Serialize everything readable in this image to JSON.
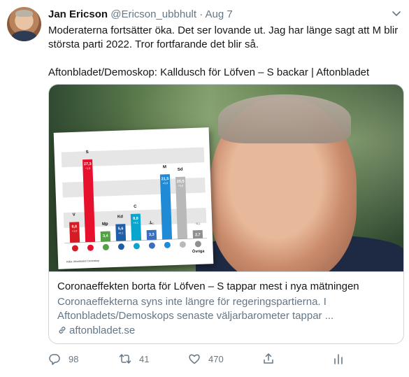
{
  "tweet": {
    "author_name": "Jan Ericson",
    "handle": "@Ericson_ubbhult",
    "separator": "·",
    "date": "Aug 7",
    "text_lines": [
      "Moderaterna fortsätter öka. Det ser lovande ut. Jag har länge sagt att M blir",
      "största parti 2022. Tror fortfarande det blir så."
    ],
    "link_line": "Aftonbladet/Demoskop: Kalldusch för Löfven – S backar | Aftonbladet"
  },
  "card": {
    "title": "Coronaeffekten borta för Löfven – S tappar mest i nya mätningen",
    "desc_lines": [
      "Coronaeffekterna syns inte längre för regeringspartierna. I",
      "Aftonbladets/Demoskops senaste väljarbarometer tappar ..."
    ],
    "domain": "aftonbladet.se"
  },
  "chart_data": {
    "type": "bar",
    "categories": [
      "V",
      "S",
      "Mp",
      "Kd",
      "C",
      "L",
      "M",
      "Sd",
      "Övriga"
    ],
    "values": [
      6.8,
      27.3,
      3.4,
      5.6,
      8.8,
      3.3,
      21.5,
      20.5,
      2.7
    ],
    "value_labels": [
      "6,8",
      "27,3",
      "3,4",
      "5,6",
      "8,8",
      "3,3",
      "21,5",
      "20,5",
      "2,7"
    ],
    "changes": [
      "+1,0",
      "−1,5",
      "−0,7",
      "+0,1",
      "+0,1",
      "+0,1",
      "+0,9",
      "+0,8",
      "−0,1"
    ],
    "colors": [
      "#d61b25",
      "#e8112d",
      "#53a045",
      "#1f5fa8",
      "#0aa5cc",
      "#3a6fbf",
      "#1f8ad6",
      "#b9b9b9",
      "#8f8f8f"
    ],
    "source": "Källa: Aftonbladet/ Demoskop",
    "ylim": [
      0,
      30
    ],
    "grid": true
  },
  "stats": {
    "replies": "98",
    "retweets": "41",
    "likes": "470"
  },
  "icons": {
    "reply": "reply-icon",
    "retweet": "retweet-icon",
    "like": "heart-icon",
    "share": "share-icon",
    "analytics": "analytics-icon",
    "more": "chevron-down-icon",
    "link": "link-icon"
  }
}
